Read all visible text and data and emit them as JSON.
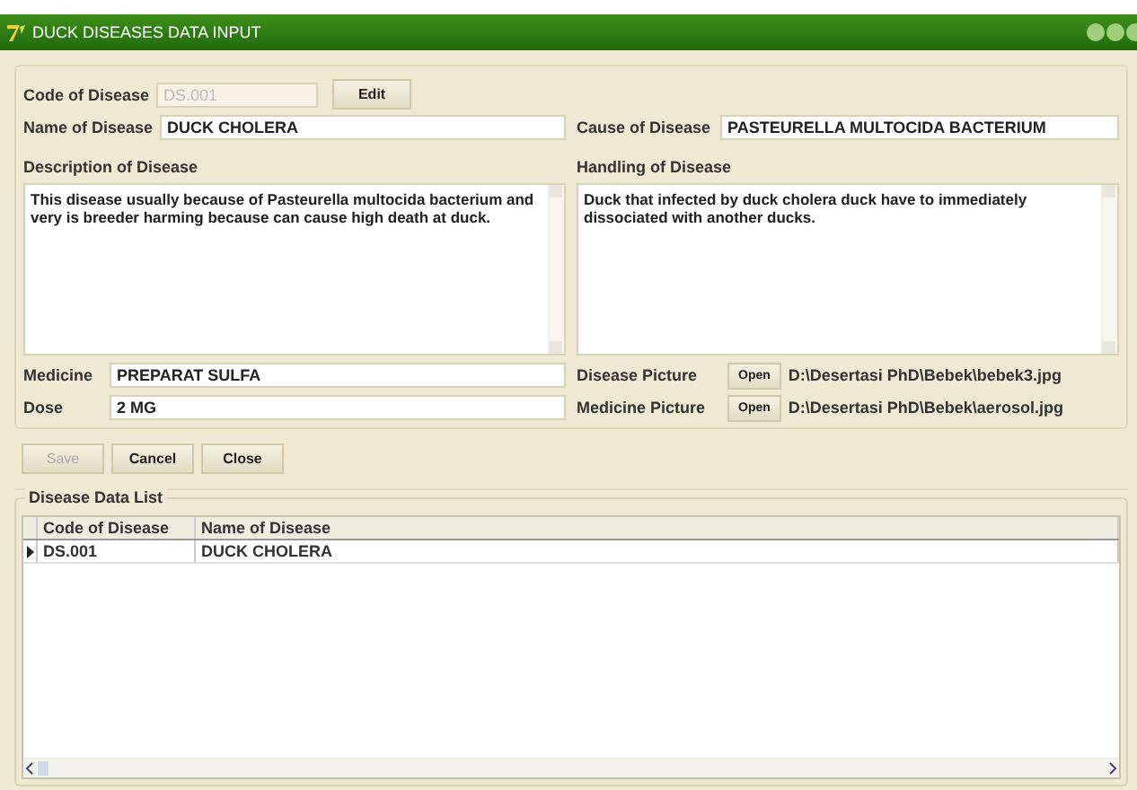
{
  "window": {
    "title": "DUCK DISEASES DATA INPUT"
  },
  "form": {
    "code": {
      "label": "Code of Disease",
      "value": "DS.001",
      "disabled": true
    },
    "edit_button": {
      "label": "Edit"
    },
    "name": {
      "label": "Name of Disease",
      "value": "DUCK CHOLERA"
    },
    "cause": {
      "label": "Cause of Disease",
      "value": "PASTEURELLA MULTOCIDA BACTERIUM"
    },
    "description": {
      "label": "Description of Disease",
      "value": "This disease usually because of Pasteurella multocida bacterium and very is breeder harming because can cause high death at duck."
    },
    "handling": {
      "label": "Handling of Disease",
      "value": "Duck that infected by duck cholera duck have to  immediately dissociated with another ducks."
    },
    "medicine": {
      "label": "Medicine",
      "value": "PREPARAT SULFA"
    },
    "dose": {
      "label": "Dose",
      "value": "2 MG"
    },
    "disease_picture": {
      "label": "Disease Picture",
      "button": "Open",
      "path": "D:\\Desertasi PhD\\Bebek\\bebek3.jpg"
    },
    "medicine_picture": {
      "label": "Medicine Picture",
      "button": "Open",
      "path": "D:\\Desertasi PhD\\Bebek\\aerosol.jpg"
    }
  },
  "buttons": [
    {
      "label": "Save",
      "disabled": true
    },
    {
      "label": "Cancel",
      "disabled": false
    },
    {
      "label": "Close",
      "disabled": false
    }
  ],
  "list": {
    "title": "Disease Data List",
    "columns": [
      "Code of Disease",
      "Name of Disease"
    ],
    "rows": [
      {
        "cells": [
          "DS.001",
          "DUCK CHOLERA"
        ],
        "selected": true
      }
    ]
  }
}
